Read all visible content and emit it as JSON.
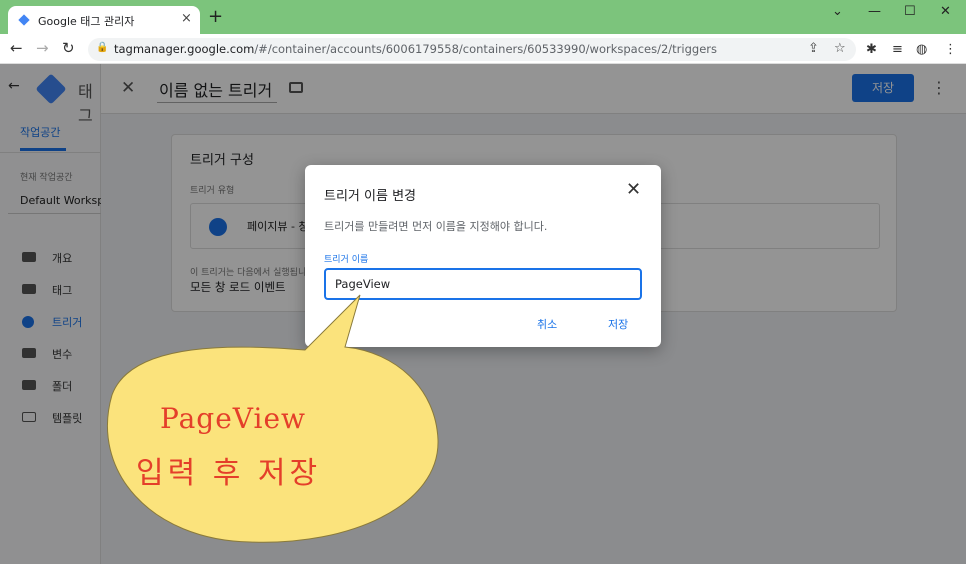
{
  "browser": {
    "tab_title": "Google 태그 관리자",
    "new_tab_icon": "+",
    "close_tab_icon": "×",
    "window_controls": [
      "⌄",
      "—",
      "☐",
      "✕"
    ],
    "url_host": "tagmanager.google.com",
    "url_path": "/#/container/accounts/6006179558/containers/60533990/workspaces/2/triggers"
  },
  "sidebar": {
    "title": "태그",
    "workspace_tab": "작업공간",
    "current_workspace_label": "현재 작업공간",
    "current_workspace": "Default Workspace",
    "items": [
      {
        "label": "개요",
        "icon": "briefcase-icon"
      },
      {
        "label": "태그",
        "icon": "tag-icon"
      },
      {
        "label": "트리거",
        "icon": "trigger-icon"
      },
      {
        "label": "변수",
        "icon": "variables-icon"
      },
      {
        "label": "폴더",
        "icon": "folder-icon"
      },
      {
        "label": "템플릿",
        "icon": "template-icon"
      }
    ]
  },
  "header": {
    "title": "이름 없는 트리거",
    "save_label": "저장"
  },
  "card": {
    "title": "트리거 구성",
    "type_label": "트리거 유형",
    "type_value": "페이지뷰 - 창 로드",
    "fires_label": "이 트리거는 다음에서 실행됩니다.",
    "fires_value": "모든 창 로드 이벤트"
  },
  "dialog": {
    "title": "트리거 이름 변경",
    "description": "트리거를 만들려면 먼저 이름을 지정해야 합니다.",
    "field_label": "트리거 이름",
    "field_value": "PageView",
    "cancel_label": "취소",
    "save_label": "저장"
  },
  "callout": {
    "line1": "PageView",
    "line2": "입력 후 저장",
    "fill_color": "#fbe37c",
    "text_color": "#e43f2a"
  }
}
